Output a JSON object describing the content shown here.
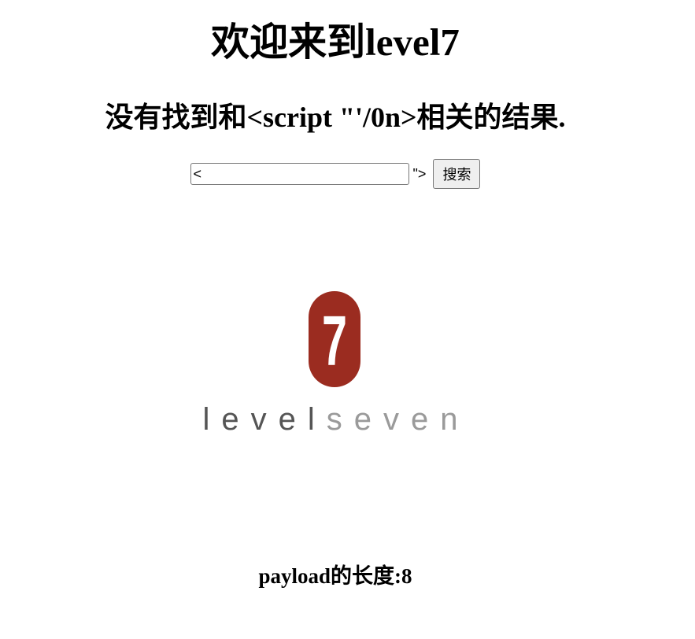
{
  "header": {
    "title": "欢迎来到level7",
    "result_text": "没有找到和<script \"'/0n>相关的结果."
  },
  "search": {
    "input_value": "<",
    "leftover_text": "\">",
    "button_label": "搜索"
  },
  "logo": {
    "digit": "7",
    "word_dark": "level",
    "word_light": "seven",
    "badge_color": "#9b2c20"
  },
  "footer": {
    "payload_text": "payload的长度:8"
  }
}
